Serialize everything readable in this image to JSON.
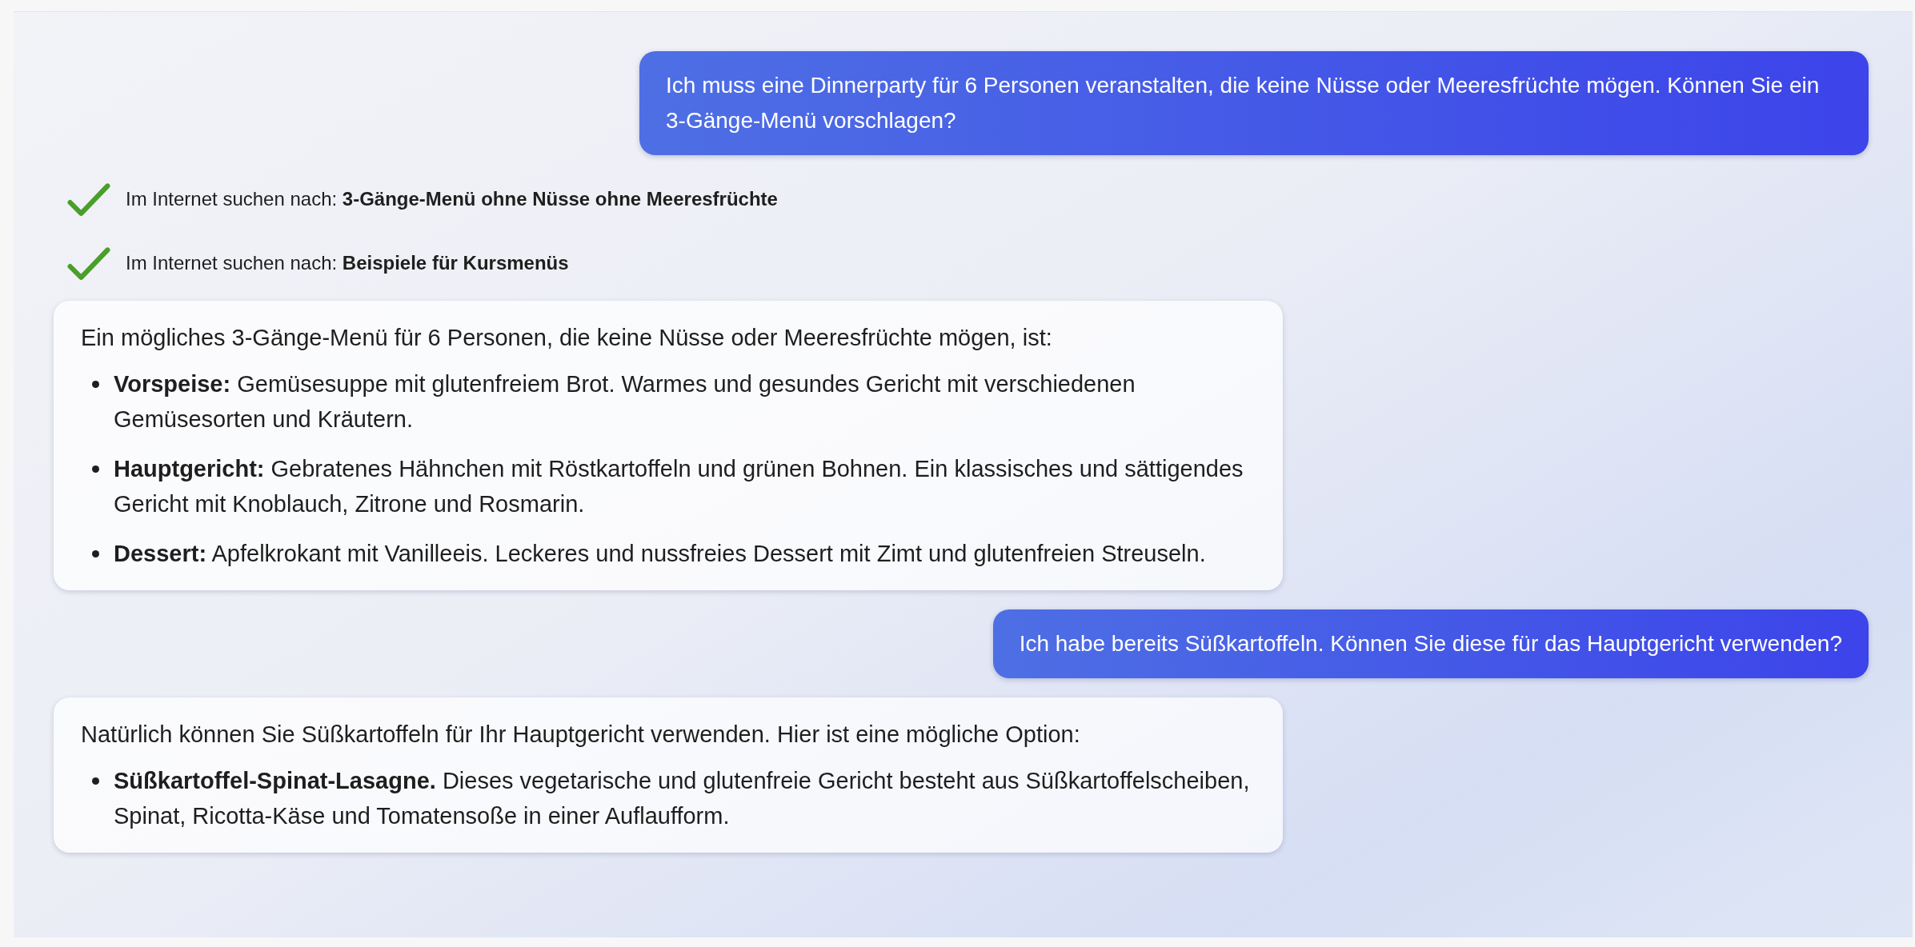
{
  "messages": [
    {
      "kind": "user",
      "text": "Ich muss eine Dinnerparty für 6 Personen veranstalten, die keine Nüsse oder Meeresfrüchte mögen. Können Sie ein 3-Gänge-Menü vorschlagen?"
    },
    {
      "kind": "search",
      "text": "Im Internet suchen nach: **3-Gänge-Menü ohne Nüsse ohne Meeresfrüchte**"
    },
    {
      "kind": "search",
      "text": "Im Internet suchen nach: **Beispiele für Kursmenüs**"
    },
    {
      "kind": "assistant",
      "intro": "Ein mögliches 3-Gänge-Menü für 6 Personen, die keine Nüsse oder Meeresfrüchte mögen, ist:",
      "items": [
        "**Vorspeise:** Gemüsesuppe mit glutenfreiem Brot. Warmes und gesundes Gericht mit verschiedenen Gemüsesorten und Kräutern.",
        "**Hauptgericht:** Gebratenes Hähnchen mit Röstkartoffeln und grünen Bohnen. Ein klassisches und sättigendes Gericht mit Knoblauch, Zitrone und Rosmarin.",
        "**Dessert:** Apfelkrokant mit Vanilleeis. Leckeres und nussfreies Dessert mit Zimt und glutenfreien Streuseln."
      ]
    },
    {
      "kind": "user",
      "text": "Ich habe bereits Süßkartoffeln. Können Sie diese für das Hauptgericht verwenden?"
    },
    {
      "kind": "assistant",
      "intro": "Natürlich können Sie Süßkartoffeln für Ihr Hauptgericht verwenden. Hier ist eine mögliche Option:",
      "items": [
        "**Süßkartoffel-Spinat-Lasagne.** Dieses vegetarische und glutenfreie Gericht besteht aus Süßkartoffelscheiben, Spinat, Ricotta-Käse und Tomatensoße in einer Auflaufform."
      ]
    }
  ]
}
